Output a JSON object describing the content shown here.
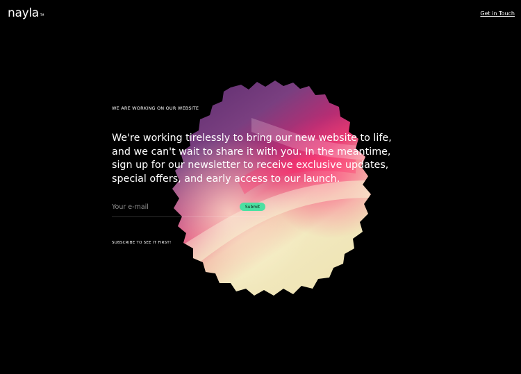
{
  "header": {
    "logo": "nayla",
    "logo_mark": "TM",
    "cta": "Get in Touch"
  },
  "hero": {
    "eyebrow": "WE ARE WORKING ON OUR WEBSITE",
    "headline": "We're working tirelessly to bring our new website to life, and we can't wait to share it with you. In the meantime, sign up for our newsletter to receive exclusive updates, special offers, and early access to our launch.",
    "email_placeholder": "Your e-mail",
    "email_value": "",
    "submit_label": "Submit",
    "subscribe_note": "SUBSCRIBE TO SEE IT FIRST!"
  },
  "colors": {
    "background": "#000000",
    "accent": "#4be0a2",
    "blob_purple": "#6b3a78",
    "blob_magenta": "#d1246e",
    "blob_cream": "#efe6b9"
  }
}
